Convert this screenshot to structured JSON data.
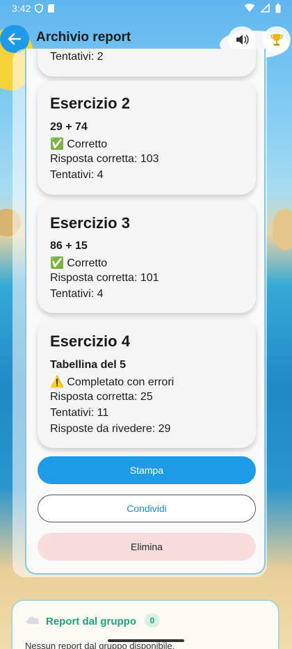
{
  "status_bar": {
    "time": "3:42"
  },
  "appbar": {
    "title": "Archivio report"
  },
  "cards": [
    {
      "lines": [
        "Tentativi: 2"
      ]
    },
    {
      "title": "Esercizio 2",
      "problem": "29 + 74",
      "status": "✅ Corretto",
      "answer": "Risposta corretta: 103",
      "attempts": "Tentativi: 4"
    },
    {
      "title": "Esercizio 3",
      "problem": "86 + 15",
      "status": "✅ Corretto",
      "answer": "Risposta corretta: 101",
      "attempts": "Tentativi: 4"
    },
    {
      "title": "Esercizio 4",
      "problem": "Tabellina del 5",
      "status": "⚠️ Completato con errori",
      "answer": "Risposta corretta: 25",
      "attempts": "Tentativi: 11",
      "review": "Risposte da rivedere: 29"
    }
  ],
  "buttons": {
    "print": "Stampa",
    "share": "Condividi",
    "delete": "Elimina"
  },
  "group": {
    "title": "Report dal gruppo",
    "count": "0",
    "empty": "Nessun report dal gruppo disponibile."
  },
  "colors": {
    "primary": "#1e9be6",
    "danger_bg": "#f9dddd",
    "group_green": "#1fa37c"
  }
}
